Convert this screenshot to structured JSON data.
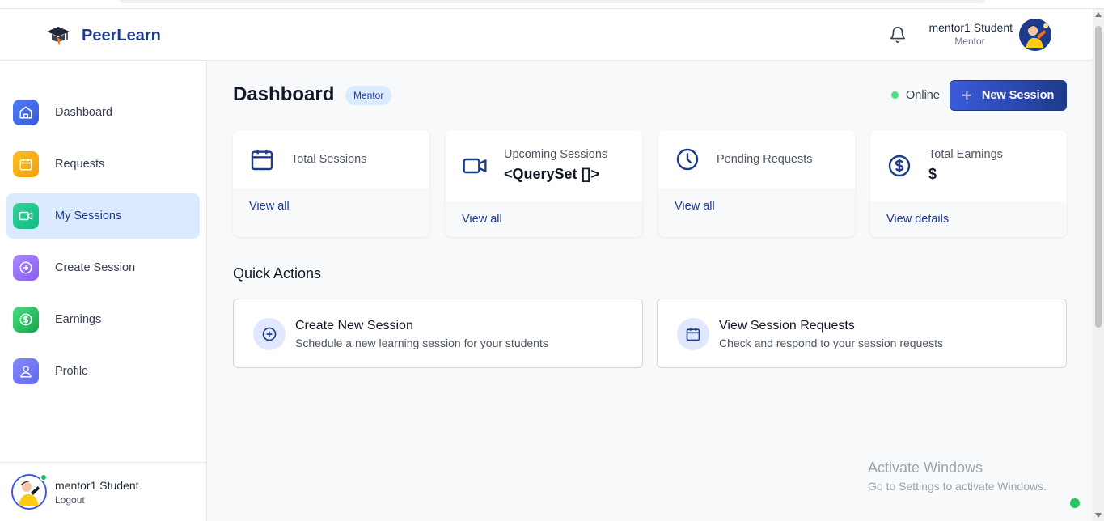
{
  "header": {
    "brand_name": "PeerLearn",
    "user_name": "mentor1 Student",
    "user_role": "Mentor"
  },
  "sidebar": {
    "items": [
      {
        "label": "Dashboard",
        "icon": "home-icon",
        "color": "#3b5bdb"
      },
      {
        "label": "Requests",
        "icon": "calendar-icon",
        "color": "#f59e0b"
      },
      {
        "label": "My Sessions",
        "icon": "video-icon",
        "color": "#10b981",
        "active": true
      },
      {
        "label": "Create Session",
        "icon": "plus-circle-icon",
        "color": "#8b5cf6"
      },
      {
        "label": "Earnings",
        "icon": "dollar-icon",
        "color": "#22c55e"
      },
      {
        "label": "Profile",
        "icon": "user-icon",
        "color": "#6366f1"
      }
    ],
    "footer": {
      "user_name": "mentor1 Student",
      "logout_label": "Logout"
    }
  },
  "main": {
    "title": "Dashboard",
    "role_badge": "Mentor",
    "status_text": "Online",
    "new_session_label": "New Session",
    "stats": [
      {
        "label": "Total Sessions",
        "value": "",
        "link": "View all",
        "icon": "calendar-icon"
      },
      {
        "label": "Upcoming Sessions",
        "value": "<QuerySet []>",
        "link": "View all",
        "icon": "video-icon"
      },
      {
        "label": "Pending Requests",
        "value": "",
        "link": "View all",
        "icon": "clock-icon"
      },
      {
        "label": "Total Earnings",
        "value": "$",
        "link": "View details",
        "icon": "dollar-icon"
      }
    ],
    "quick_actions_title": "Quick Actions",
    "quick_actions": [
      {
        "title": "Create New Session",
        "subtitle": "Schedule a new learning session for your students",
        "icon": "plus-circle-icon"
      },
      {
        "title": "View Session Requests",
        "subtitle": "Check and respond to your session requests",
        "icon": "calendar-icon"
      }
    ]
  },
  "watermark": {
    "line1": "Activate Windows",
    "line2": "Go to Settings to activate Windows."
  }
}
